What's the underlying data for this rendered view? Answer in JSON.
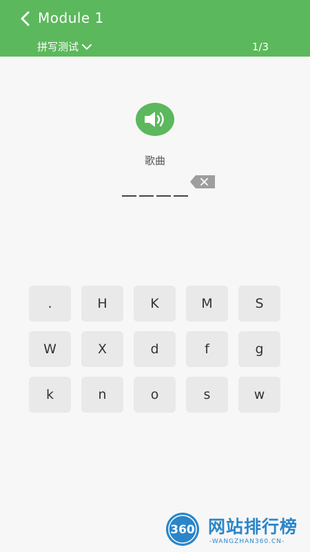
{
  "header": {
    "title": "Module 1",
    "mode_label": "拼写测试",
    "progress": "1/3",
    "color": "#5cb85c"
  },
  "question": {
    "word": "歌曲",
    "blank_count": 4
  },
  "keyboard": {
    "keys": [
      ".",
      "H",
      "K",
      "M",
      "S",
      "W",
      "X",
      "d",
      "f",
      "g",
      "k",
      "n",
      "o",
      "s",
      "w"
    ]
  },
  "watermark": {
    "badge": "360",
    "text": "网站排行榜",
    "subtext": "-WANGZHAN360.CN-"
  },
  "icons": {
    "back": "chevron-left-icon",
    "dropdown": "chevron-down-icon",
    "audio": "speaker-icon",
    "delete": "backspace-icon"
  }
}
